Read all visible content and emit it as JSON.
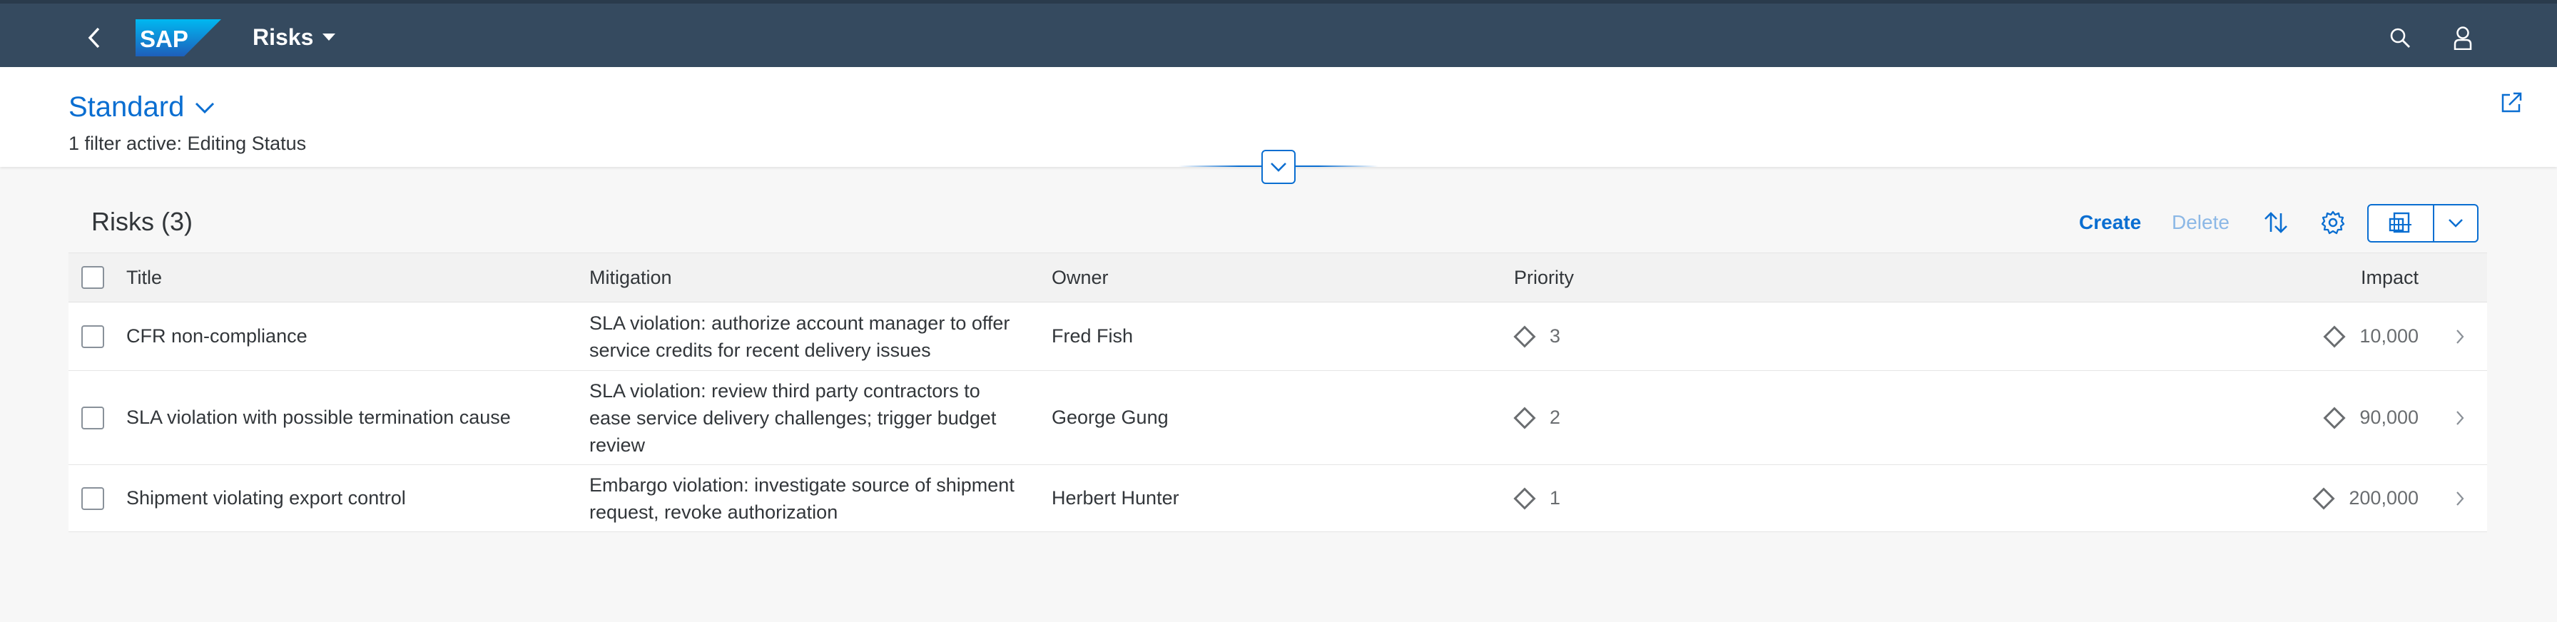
{
  "shell": {
    "logo_text": "SAP",
    "app_title": "Risks",
    "icons": [
      "back-icon",
      "search-icon",
      "user-icon"
    ]
  },
  "header": {
    "variant_name": "Standard",
    "filter_status": "1 filter active: Editing Status",
    "icons": [
      "chevron-down-icon",
      "share-icon"
    ]
  },
  "toolbar": {
    "table_title": "Risks (3)",
    "create_label": "Create",
    "delete_label": "Delete",
    "icons": [
      "sort-icon",
      "settings-icon",
      "export-icon",
      "chevron-down-icon"
    ]
  },
  "table": {
    "columns": [
      "Title",
      "Mitigation",
      "Owner",
      "Priority",
      "Impact"
    ],
    "rows": [
      {
        "title": "CFR non-compliance",
        "mitigation": [
          "SLA violation: authorize account manager to offer",
          "service credits for recent delivery issues"
        ],
        "owner": "Fred Fish",
        "priority": "3",
        "impact": "10,000"
      },
      {
        "title": "SLA violation with possible termination cause",
        "mitigation": [
          "SLA violation: review third party contractors to",
          "ease service delivery challenges; trigger budget",
          "review"
        ],
        "owner": "George Gung",
        "priority": "2",
        "impact": "90,000"
      },
      {
        "title": "Shipment violating export control",
        "mitigation": [
          "Embargo violation: investigate source of shipment",
          "request, revoke authorization"
        ],
        "owner": "Herbert Hunter",
        "priority": "1",
        "impact": "200,000"
      }
    ]
  },
  "colors": {
    "shell_bg": "#354a5f",
    "accent": "#0a6ed1",
    "link_disabled": "#8cb8e6",
    "text": "#32363a",
    "muted": "#6a6d70"
  }
}
